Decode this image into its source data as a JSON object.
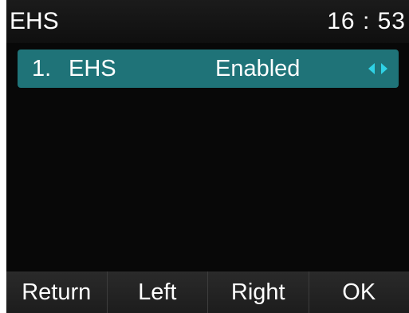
{
  "header": {
    "title": "EHS",
    "time": "16 : 53"
  },
  "menu": {
    "items": [
      {
        "index": "1.",
        "label": "EHS",
        "value": "Enabled",
        "selected": true,
        "icons": [
          "left-arrow-icon",
          "right-arrow-icon"
        ]
      }
    ]
  },
  "softkeys": [
    {
      "label": "Return"
    },
    {
      "label": "Left"
    },
    {
      "label": "Right"
    },
    {
      "label": "OK"
    }
  ],
  "colors": {
    "selection": "#1f7378",
    "arrow": "#2fd3e6",
    "background": "#080808",
    "text": "#ffffff"
  }
}
